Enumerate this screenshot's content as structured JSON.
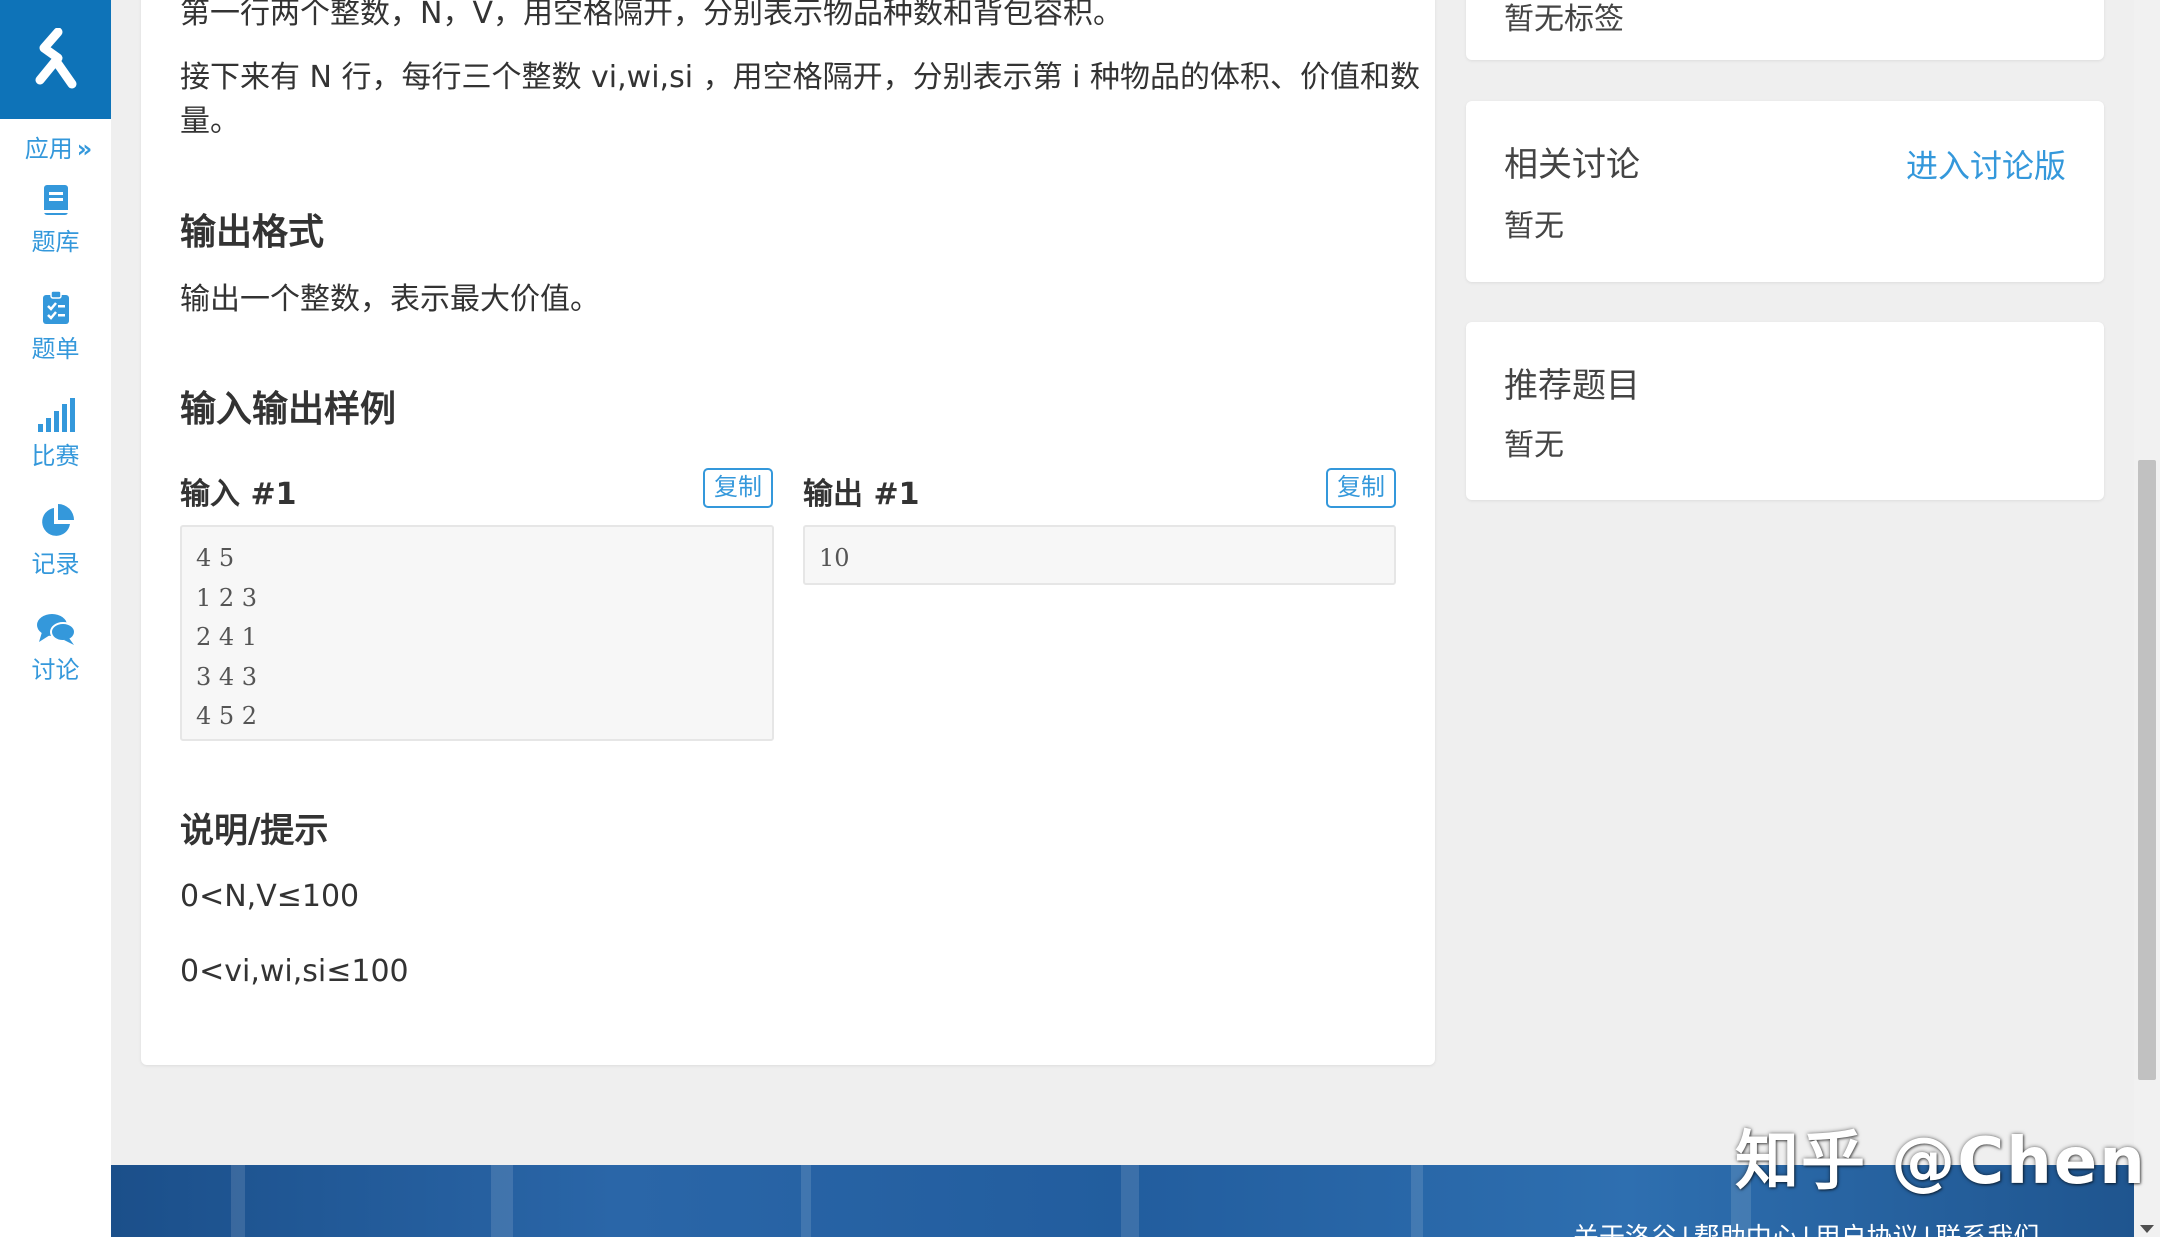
{
  "sidebar": {
    "apps_label": "应用",
    "apps_chevron": "»",
    "items": [
      {
        "label": "题库",
        "icon": "book-icon"
      },
      {
        "label": "题单",
        "icon": "clipboard-icon"
      },
      {
        "label": "比赛",
        "icon": "bar-chart-icon"
      },
      {
        "label": "记录",
        "icon": "pie-chart-icon"
      },
      {
        "label": "讨论",
        "icon": "comments-icon"
      }
    ],
    "accent_color": "#3498db",
    "logo_bg": "#0e73b8"
  },
  "problem": {
    "input_line1": "第一行两个整数，N，V，用空格隔开，分别表示物品种数和背包容积。",
    "input_line2": "接下来有 N 行，每行三个整数 vi,wi,si ，用空格隔开，分别表示第 i 种物品的体积、价值和数量。",
    "output_heading": "输出格式",
    "output_text": "输出一个整数，表示最大价值。",
    "samples_heading": "输入输出样例",
    "input_label": "输入 #1",
    "output_label": "输出 #1",
    "copy_label": "复制",
    "sample_input": [
      "4 5",
      "1 2 3",
      "2 4 1",
      "3 4 3",
      "4 5 2"
    ],
    "sample_output": [
      "10"
    ],
    "hint_heading": "说明/提示",
    "hints": [
      "0<N,V≤100",
      "0<vi,wi,si≤100"
    ]
  },
  "right": {
    "tags_text": "暂无标签",
    "discuss_title": "相关讨论",
    "discuss_link": "进入讨论版",
    "discuss_body": "暂无",
    "recommend_title": "推荐题目",
    "recommend_body": "暂无"
  },
  "footer": {
    "links": [
      "关于洛谷",
      "帮助中心",
      "用户协议",
      "联系我们"
    ],
    "separator": "|"
  },
  "watermark": "知乎 @Chen"
}
